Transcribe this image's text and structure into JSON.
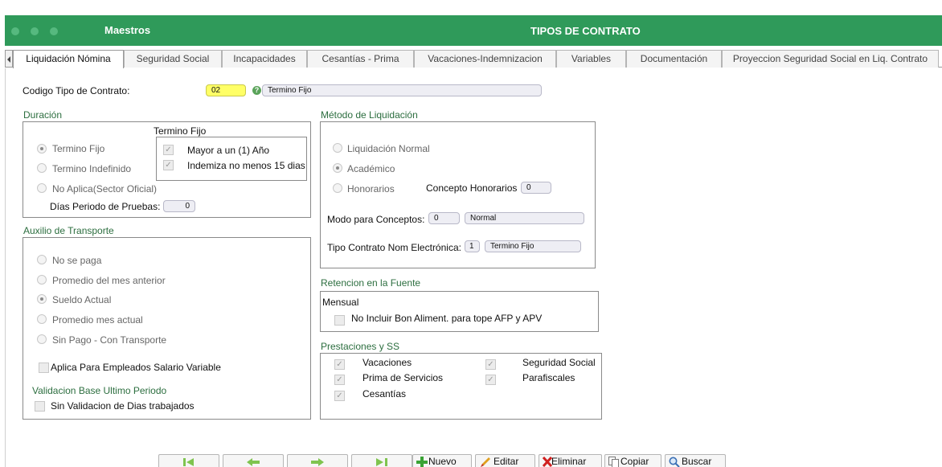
{
  "window": {
    "app_title": "Maestros",
    "page_title": "TIPOS DE CONTRATO"
  },
  "tabs": [
    {
      "label": "Liquidación Nómina",
      "active": true
    },
    {
      "label": "Seguridad Social"
    },
    {
      "label": "Incapacidades"
    },
    {
      "label": "Cesantías - Prima"
    },
    {
      "label": "Vacaciones-Indemnizacion"
    },
    {
      "label": "Variables"
    },
    {
      "label": "Documentación"
    },
    {
      "label": "Proyeccion Seguridad Social en Liq. Contrato"
    }
  ],
  "codigo": {
    "label": "Codigo Tipo de Contrato:",
    "code": "02",
    "name": "Termino Fijo"
  },
  "duracion": {
    "title": "Duración",
    "options": [
      {
        "label": "Termino Fijo",
        "selected": true
      },
      {
        "label": "Termino Indefinido",
        "selected": false
      },
      {
        "label": "No Aplica(Sector Oficial)",
        "selected": false
      }
    ],
    "termino_fijo": {
      "title": "Termino Fijo",
      "checks": [
        {
          "label": "Mayor a un (1) Año",
          "checked": true
        },
        {
          "label": "Indemiza no menos 15 dias",
          "checked": true
        }
      ]
    },
    "dias_prueba_label": "Días Periodo de Pruebas:",
    "dias_prueba_value": "0"
  },
  "auxilio": {
    "title": "Auxilio de Transporte",
    "options": [
      {
        "label": "No se paga",
        "selected": false
      },
      {
        "label": "Promedio del mes anterior",
        "selected": false
      },
      {
        "label": "Sueldo Actual",
        "selected": true
      },
      {
        "label": "Promedio mes actual",
        "selected": false
      },
      {
        "label": "Sin Pago - Con Transporte",
        "selected": false
      }
    ],
    "salario_variable": {
      "label": "Aplica Para Empleados Salario Variable",
      "checked": false
    }
  },
  "validacion": {
    "title": "Validacion Base Ultimo Periodo",
    "check": {
      "label": "Sin Validacion de Dias trabajados",
      "checked": false
    }
  },
  "metodo": {
    "title": "Método de Liquidación",
    "options": [
      {
        "label": "Liquidación Normal",
        "selected": false
      },
      {
        "label": "Académico",
        "selected": true
      },
      {
        "label": "Honorarios",
        "selected": false
      }
    ],
    "concepto_honorarios_label": "Concepto Honorarios",
    "concepto_honorarios_value": "0",
    "modo_label": "Modo para Conceptos:",
    "modo_code": "0",
    "modo_name": "Normal",
    "tipo_nom_label": "Tipo Contrato Nom Electrónica:",
    "tipo_nom_code": "1",
    "tipo_nom_name": "Termino Fijo"
  },
  "retencion": {
    "title": "Retencion en la Fuente",
    "sub": "Mensual",
    "check": {
      "label": "No Incluir Bon Aliment. para tope AFP y APV",
      "checked": false
    }
  },
  "prestaciones": {
    "title": "Prestaciones y SS",
    "checks": [
      {
        "label": "Vacaciones",
        "checked": true
      },
      {
        "label": "Prima de Servicios",
        "checked": true
      },
      {
        "label": "Cesantías",
        "checked": true
      },
      {
        "label": "Seguridad Social",
        "checked": true
      },
      {
        "label": "Parafiscales",
        "checked": true
      }
    ]
  },
  "toolbar": {
    "nuevo": "Nuevo",
    "editar": "Editar",
    "eliminar": "Eliminar",
    "copiar": "Copiar",
    "buscar": "Buscar"
  },
  "colors": {
    "header": "#2f9a5a",
    "section_title": "#2c6e3f",
    "code_field": "#ffff66"
  }
}
